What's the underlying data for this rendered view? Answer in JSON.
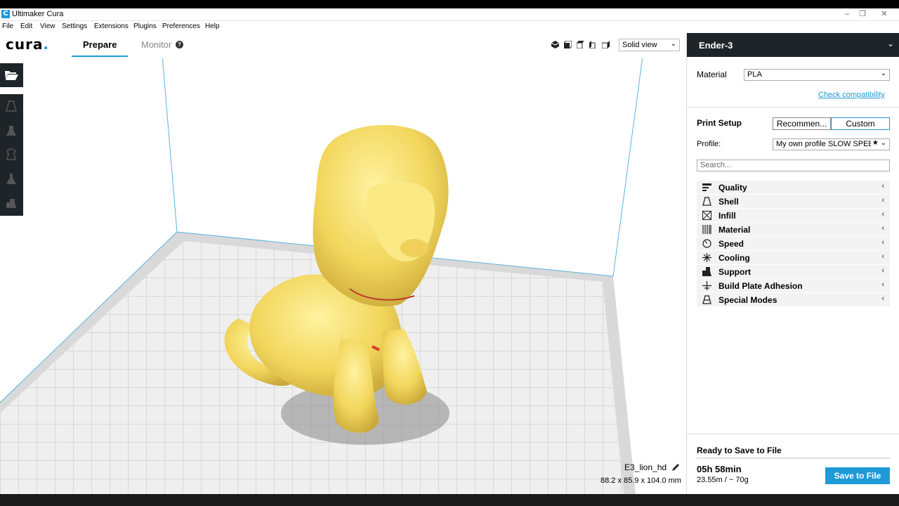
{
  "window": {
    "app_icon": "C",
    "title": "Ultimaker Cura",
    "controls": [
      "minimize-icon",
      "restore-icon",
      "close-icon"
    ]
  },
  "menu": [
    "File",
    "Edit",
    "View",
    "Settings",
    "Extensions",
    "Plugins",
    "Preferences",
    "Help"
  ],
  "header": {
    "logo": "cura",
    "tabs": [
      {
        "label": "Prepare",
        "active": true
      },
      {
        "label": "Monitor",
        "active": false
      }
    ],
    "help_icon": "?",
    "view_mode": "Solid view",
    "view_icons": [
      "3d-view-icon",
      "front-view-icon",
      "top-view-icon",
      "left-view-icon",
      "right-view-icon"
    ]
  },
  "toolbar": {
    "open_icon": "folder-open-icon",
    "tools": [
      "move-icon",
      "scale-icon",
      "rotate-icon",
      "mirror-icon",
      "per-model-settings-icon"
    ]
  },
  "object": {
    "name": "E3_lion_hd",
    "dimensions": "88.2 x 85.9 x 104.0 mm"
  },
  "panel": {
    "printer": "Ender-3",
    "material_label": "Material",
    "material_value": "PLA",
    "check_link": "Check compatibility",
    "print_setup_label": "Print Setup",
    "mode_buttons": [
      {
        "label": "Recommen...",
        "active": false
      },
      {
        "label": "Custom",
        "active": true
      }
    ],
    "profile_label": "Profile:",
    "profile_value": "My own profile SLOW SPEED",
    "search_placeholder": "Search...",
    "categories": [
      {
        "label": "Quality",
        "icon": "quality-icon"
      },
      {
        "label": "Shell",
        "icon": "shell-icon"
      },
      {
        "label": "Infill",
        "icon": "infill-icon"
      },
      {
        "label": "Material",
        "icon": "material-icon"
      },
      {
        "label": "Speed",
        "icon": "speed-icon"
      },
      {
        "label": "Cooling",
        "icon": "cooling-icon"
      },
      {
        "label": "Support",
        "icon": "support-icon"
      },
      {
        "label": "Build Plate Adhesion",
        "icon": "adhesion-icon"
      },
      {
        "label": "Special Modes",
        "icon": "special-modes-icon"
      }
    ],
    "ready_label": "Ready to Save to File",
    "print_time": "05h 58min",
    "material_usage": "23.55m / ~ 70g",
    "save_button": "Save to File"
  },
  "colors": {
    "accent": "#1f9ad6",
    "dark": "#1e2428",
    "model": "#f5e06a"
  }
}
